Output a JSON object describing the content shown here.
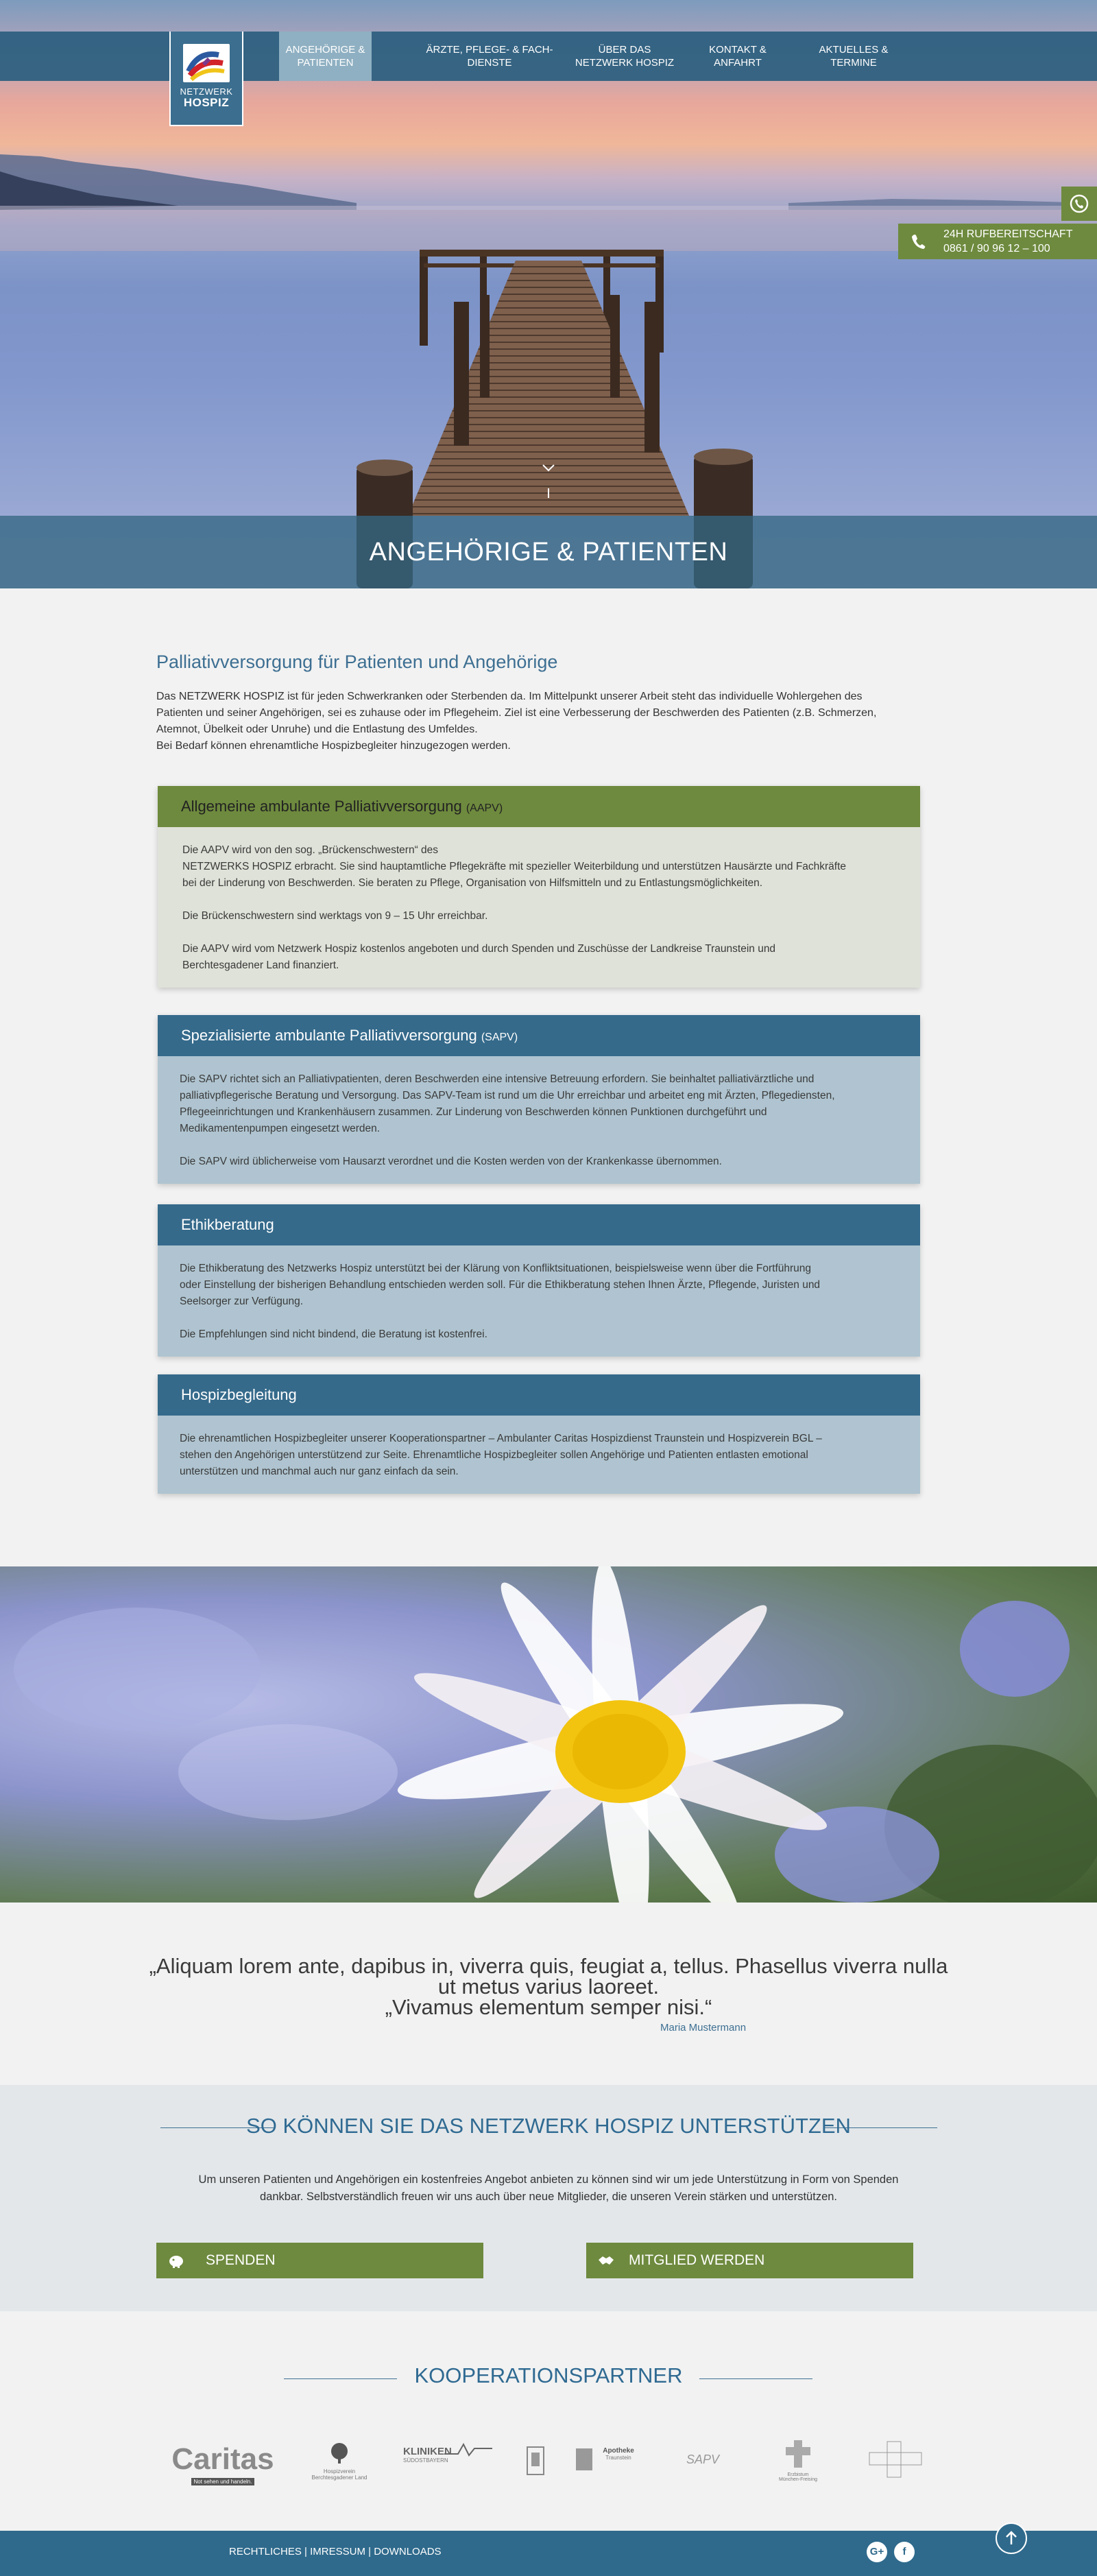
{
  "nav": {
    "logo_line1": "NETZWERK",
    "logo_line2": "HOSPIZ",
    "items": [
      {
        "line1": "Angehörige &",
        "line2": "Patienten"
      },
      {
        "line1": "Ärzte, Pflege- & Fach-",
        "line2": "dienste"
      },
      {
        "line1": "Über das",
        "line2": "Netzwerk Hospiz"
      },
      {
        "line1": "Kontakt &",
        "line2": "Anfahrt"
      },
      {
        "line1": "Aktuelles &",
        "line2": "Termine"
      }
    ]
  },
  "hotline": {
    "label": "24H RUFBEREITSCHAFT",
    "number": "0861 / 90 96 12 – 100"
  },
  "hero": {
    "title": "ANGEHÖRIGE & PATIENTEN"
  },
  "main": {
    "heading": "Palliativversorgung für Patienten und Angehörige",
    "intro": [
      "Das NETZWERK HOSPIZ ist für jeden Schwerkranken oder Sterbenden da. Im Mittelpunkt unserer Arbeit steht das individuelle Wohlergehen des",
      "Patienten und seiner Angehörigen, sei es zuhause oder im Pflegeheim. Ziel ist eine Verbesserung der Beschwerden des Patienten (z.B. Schmerzen,",
      "Atemnot, Übelkeit oder Unruhe) und die Entlastung des Umfeldes.",
      "Bei Bedarf können ehrenamtliche Hospizbegleiter hinzugezogen werden."
    ]
  },
  "boxes": [
    {
      "title": "Allgemeine ambulante Palliativversorgung",
      "abbr": "(AAPV)",
      "paragraphs": [
        [
          "Die AAPV wird von den sog. „Brückenschwestern“ des",
          "NETZWERKS HOSPIZ erbracht. Sie sind hauptamtliche Pflegekräfte mit spezieller Weiterbildung und unterstützen Hausärzte und Fachkräfte",
          "bei der Linderung von Beschwerden. Sie beraten zu Pflege, Organisation von Hilfsmitteln  und zu Entlastungsmöglichkeiten."
        ],
        [
          "Die Brückenschwestern sind  werktags von 9 – 15 Uhr erreichbar."
        ],
        [
          "Die AAPV wird vom Netzwerk Hospiz  kostenlos angeboten und durch Spenden und Zuschüsse der Landkreise Traunstein und",
          "Berchtesgadener Land finanziert."
        ]
      ]
    },
    {
      "title": "Spezialisierte ambulante Palliativversorgung",
      "abbr": "(SAPV)",
      "paragraphs": [
        [
          "Die SAPV richtet sich an Palliativpatienten, deren Beschwerden eine intensive Betreuung erfordern. Sie beinhaltet palliativärztliche und",
          "palliativpflegerische Beratung und Versorgung. Das  SAPV-Team ist rund um die Uhr erreichbar und arbeitet eng mit Ärzten, Pflegediensten,",
          "Pflegeeinrichtungen und Krankenhäusern zusammen. Zur Linderung von Beschwerden können Punktionen durchgeführt und",
          "Medikamentenpumpen eingesetzt werden."
        ],
        [
          "Die SAPV wird üblicherweise vom Hausarzt  verordnet und die Kosten werden von der Krankenkasse übernommen."
        ]
      ]
    },
    {
      "title": "Ethikberatung",
      "abbr": "",
      "paragraphs": [
        [
          "Die Ethikberatung des Netzwerks Hospiz unterstützt bei der Klärung  von Konfliktsituationen, beispielsweise wenn über die Fortführung",
          "oder Einstellung der bisherigen Behandlung entschieden werden soll. Für die Ethikberatung stehen Ihnen Ärzte, Pflegende, Juristen und",
          "Seelsorger zur Verfügung."
        ],
        [
          "Die Empfehlungen sind nicht bindend, die Beratung ist kostenfrei."
        ]
      ]
    },
    {
      "title": "Hospizbegleitung",
      "abbr": "",
      "paragraphs": [
        [
          "Die ehrenamtlichen Hospizbegleiter unserer Kooperationspartner – Ambulanter Caritas Hospizdienst Traunstein und Hospizverein BGL –",
          "stehen den Angehörigen unterstützend zur Seite. Ehrenamtliche Hospizbegleiter sollen Angehörige und Patienten entlasten emotional",
          "unterstützen und manchmal auch nur ganz einfach da sein."
        ]
      ]
    }
  ],
  "quote": {
    "line1": "„Aliquam lorem ante, dapibus in, viverra quis, feugiat a, tellus. Phasellus viverra nulla",
    "line2": "ut metus varius laoreet.",
    "line3": "„Vivamus elementum semper nisi.“",
    "author": "Maria Mustermann"
  },
  "support": {
    "title": "So können Sie das Netzwerk Hospiz unterstützen",
    "text_line1": "Um unseren Patienten und Angehörigen ein kostenfreies Angebot anbieten zu können sind wir um jede Unterstützung in Form von Spenden",
    "text_line2": "dankbar. Selbstverständlich freuen wir uns auch über neue Mitglieder, die unseren Verein stärken und unterstützen.",
    "donate_label": "Spenden",
    "member_label": "Mitglied werden"
  },
  "partners": {
    "title": "Kooperationspartner",
    "logos": [
      {
        "name": "Caritas",
        "sub": "Not sehen und handeln."
      },
      {
        "name": "Hospizverein",
        "sub": "Berchtesgadener Land"
      },
      {
        "name": "KLINIKEN",
        "sub": "SÜDOSTBAYERN"
      },
      {
        "name": "",
        "sub": ""
      },
      {
        "name": "Apotheke",
        "sub": "Traunstein"
      },
      {
        "name": "SAPV",
        "sub": ""
      },
      {
        "name": "Erzbistum",
        "sub": "München-Freising"
      },
      {
        "name": "",
        "sub": ""
      }
    ]
  },
  "footer": {
    "link1": "RECHTLICHES",
    "link2": "IMRESSUM",
    "link3": "DOWNLOADS",
    "sep": "|",
    "gplus": "G+",
    "fb": "f"
  },
  "colors": {
    "blue": "#356a8b",
    "green": "#6e8a3e",
    "light_blue_box": "#afc4d0",
    "light_green_box": "#dfe2d8"
  }
}
